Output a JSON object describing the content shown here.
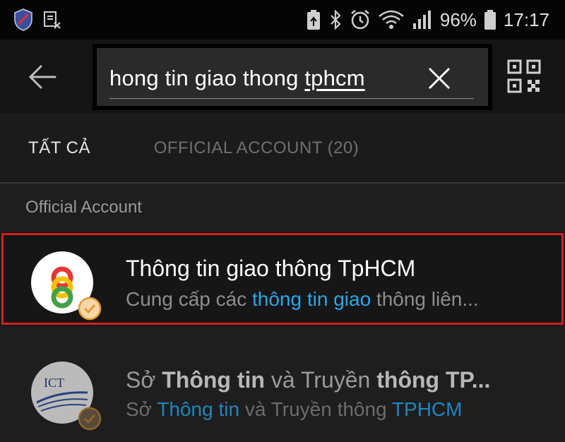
{
  "status_bar": {
    "battery_percent": "96%",
    "time": "17:17",
    "icons": [
      "shield-app-icon",
      "screenshot-icon",
      "battery-saver-icon",
      "bluetooth-icon",
      "alarm-icon",
      "wifi-icon",
      "signal-icon",
      "battery-icon"
    ]
  },
  "search": {
    "query_prefix": "hong tin giao thong ",
    "query_underlined": "tphcm"
  },
  "tabs": [
    {
      "label": "TẤT CẢ",
      "selected": true
    },
    {
      "label": "OFFICIAL ACCOUNT (20)",
      "selected": false
    }
  ],
  "section_header": "Official Account",
  "results": [
    {
      "title": "Thông tin giao thông TpHCM",
      "subtitle_parts": [
        "Cung cấp các ",
        "thông tin giao",
        " thông liên..."
      ],
      "selected": true,
      "verified": true
    },
    {
      "title_parts": [
        "Sở ",
        "Thông tin",
        " và Truyền ",
        "thông TP..."
      ],
      "subtitle_parts": [
        "Sở ",
        "Thông tin",
        " và Truyền thông ",
        "TPHCM"
      ],
      "avatar_text": "ICT",
      "verified": true
    }
  ],
  "colors": {
    "highlight": "#2aa7e8",
    "selection_outline": "#d81e1e",
    "verified_badge": "#e39a3a"
  }
}
